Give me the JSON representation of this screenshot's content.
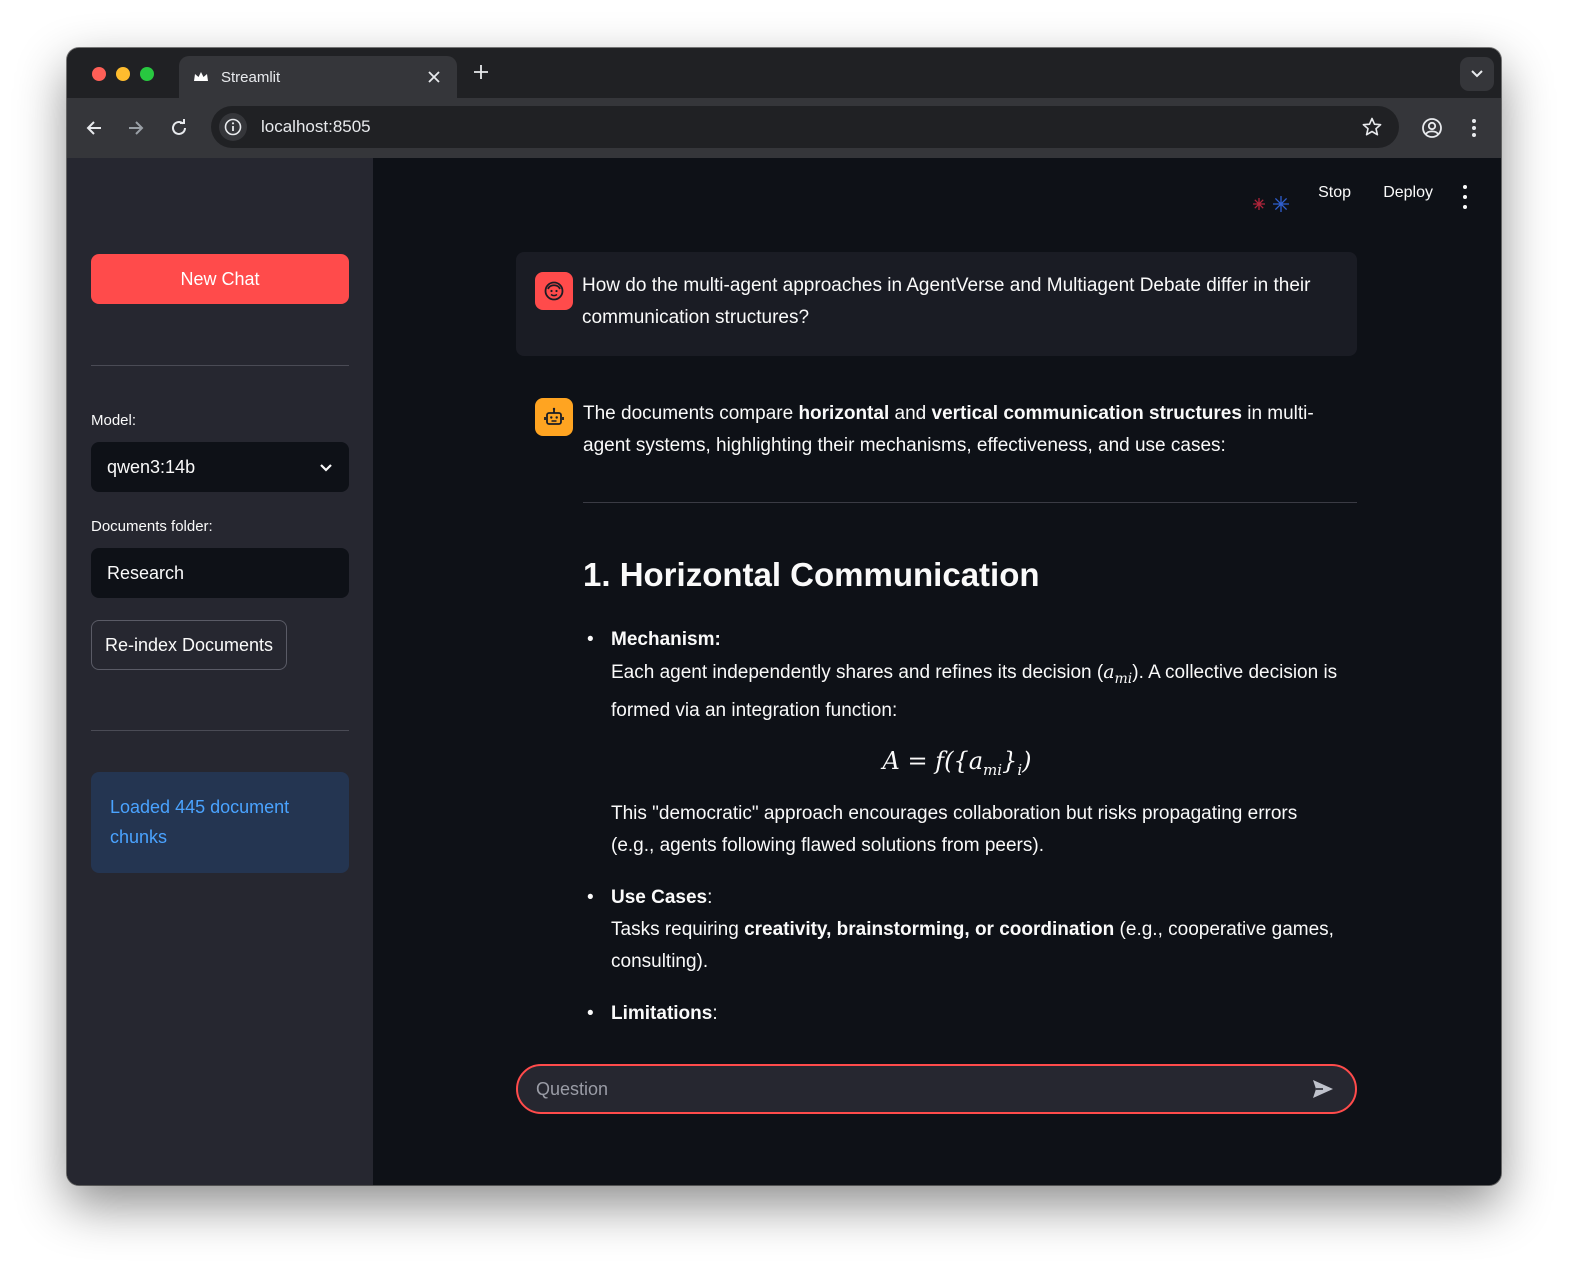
{
  "browser": {
    "tab_title": "Streamlit",
    "url": "localhost:8505",
    "icons": {
      "favicon": "streamlit-crown-icon",
      "close": "close-icon",
      "new_tab": "plus-icon",
      "tab_menu": "chevron-down-icon",
      "back": "arrow-left-icon",
      "forward": "arrow-right-icon",
      "reload": "reload-icon",
      "site_info": "info-icon",
      "bookmark": "star-icon",
      "profile": "account-icon",
      "menu": "kebab-menu-icon"
    }
  },
  "sidebar": {
    "new_chat_label": "New Chat",
    "model_label": "Model:",
    "model_value": "qwen3:14b",
    "docs_label": "Documents folder:",
    "docs_value": "Research",
    "reindex_label": "Re-index Documents",
    "status_message": "Loaded 445 document chunks"
  },
  "header": {
    "stop_label": "Stop",
    "deploy_label": "Deploy"
  },
  "chat": {
    "user_message": "How do the multi-agent approaches in AgentVerse and Multiagent Debate differ in their communication structures?",
    "assistant": {
      "intro_pre": "The documents compare ",
      "intro_b1": "horizontal",
      "intro_mid": " and ",
      "intro_b2": "vertical communication structures",
      "intro_post": " in multi-agent systems, highlighting their mechanisms, effectiveness, and use cases:",
      "section_heading": "1. Horizontal Communication",
      "mechanism_label": "Mechanism",
      "mechanism_text_pre": "Each agent independently shares and refines its decision (",
      "mechanism_var": "a",
      "mechanism_sub": "mi",
      "mechanism_text_post": "). A collective decision is formed via an integration function:",
      "formula": "A = f({a",
      "formula_sub": "mi",
      "formula_post": "}",
      "formula_sub2": "i",
      "formula_end": ")",
      "mechanism_note": "This \"democratic\" approach encourages collaboration but risks propagating errors (e.g., agents following flawed solutions from peers).",
      "usecases_label": "Use Cases",
      "usecases_pre": "Tasks requiring ",
      "usecases_bold": "creativity, brainstorming, or coordination",
      "usecases_post": " (e.g., cooperative games, consulting).",
      "limitations_label": "Limitations",
      "colon": ":"
    },
    "input_placeholder": "Question"
  },
  "colors": {
    "accent": "#ff4b4b",
    "sidebar_bg": "#262730",
    "app_bg": "#0e1117",
    "info_bg": "#243551",
    "info_text": "#4aa3ff",
    "bot_avatar": "#ffa421"
  }
}
